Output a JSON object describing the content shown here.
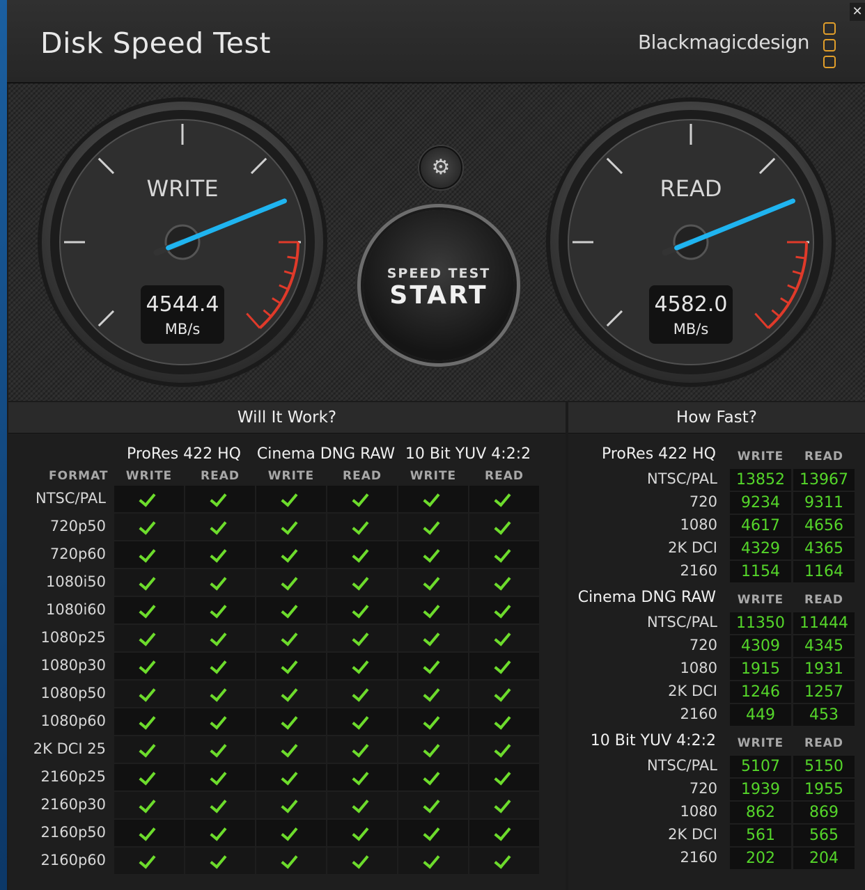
{
  "app": {
    "title": "Disk Speed Test",
    "brand": "Blackmagicdesign",
    "close_glyph": "✕"
  },
  "gauges": {
    "write": {
      "label": "WRITE",
      "value": "4544.4",
      "unit": "MB/s"
    },
    "read": {
      "label": "READ",
      "value": "4582.0",
      "unit": "MB/s"
    }
  },
  "start_button": {
    "line1": "SPEED TEST",
    "line2": "START"
  },
  "settings_icon": "⚙",
  "will_it_work": {
    "title": "Will It Work?",
    "format_header": "FORMAT",
    "codecs": [
      "ProRes 422 HQ",
      "Cinema DNG RAW",
      "10 Bit YUV 4:2:2"
    ],
    "columns": [
      "WRITE",
      "READ",
      "WRITE",
      "READ",
      "WRITE",
      "READ"
    ],
    "formats": [
      "NTSC/PAL",
      "720p50",
      "720p60",
      "1080i50",
      "1080i60",
      "1080p25",
      "1080p30",
      "1080p50",
      "1080p60",
      "2K DCI 25",
      "2160p25",
      "2160p30",
      "2160p50",
      "2160p60"
    ],
    "all_supported": true
  },
  "how_fast": {
    "title": "How Fast?",
    "sections": [
      {
        "codec": "ProRes 422 HQ",
        "write_h": "WRITE",
        "read_h": "READ",
        "rows": [
          {
            "label": "NTSC/PAL",
            "write": "13852",
            "read": "13967"
          },
          {
            "label": "720",
            "write": "9234",
            "read": "9311"
          },
          {
            "label": "1080",
            "write": "4617",
            "read": "4656"
          },
          {
            "label": "2K DCI",
            "write": "4329",
            "read": "4365"
          },
          {
            "label": "2160",
            "write": "1154",
            "read": "1164"
          }
        ]
      },
      {
        "codec": "Cinema DNG RAW",
        "write_h": "WRITE",
        "read_h": "READ",
        "rows": [
          {
            "label": "NTSC/PAL",
            "write": "11350",
            "read": "11444"
          },
          {
            "label": "720",
            "write": "4309",
            "read": "4345"
          },
          {
            "label": "1080",
            "write": "1915",
            "read": "1931"
          },
          {
            "label": "2K DCI",
            "write": "1246",
            "read": "1257"
          },
          {
            "label": "2160",
            "write": "449",
            "read": "453"
          }
        ]
      },
      {
        "codec": "10 Bit YUV 4:2:2",
        "write_h": "WRITE",
        "read_h": "READ",
        "rows": [
          {
            "label": "NTSC/PAL",
            "write": "5107",
            "read": "5150"
          },
          {
            "label": "720",
            "write": "1939",
            "read": "1955"
          },
          {
            "label": "1080",
            "write": "862",
            "read": "869"
          },
          {
            "label": "2K DCI",
            "write": "561",
            "read": "565"
          },
          {
            "label": "2160",
            "write": "202",
            "read": "204"
          }
        ]
      }
    ]
  },
  "colors": {
    "accent_needle": "#1fb4f0",
    "check_green": "#6ddc2c",
    "value_green": "#55d62a",
    "redline": "#e03a2a",
    "logo_orange": "#e19e2a"
  }
}
